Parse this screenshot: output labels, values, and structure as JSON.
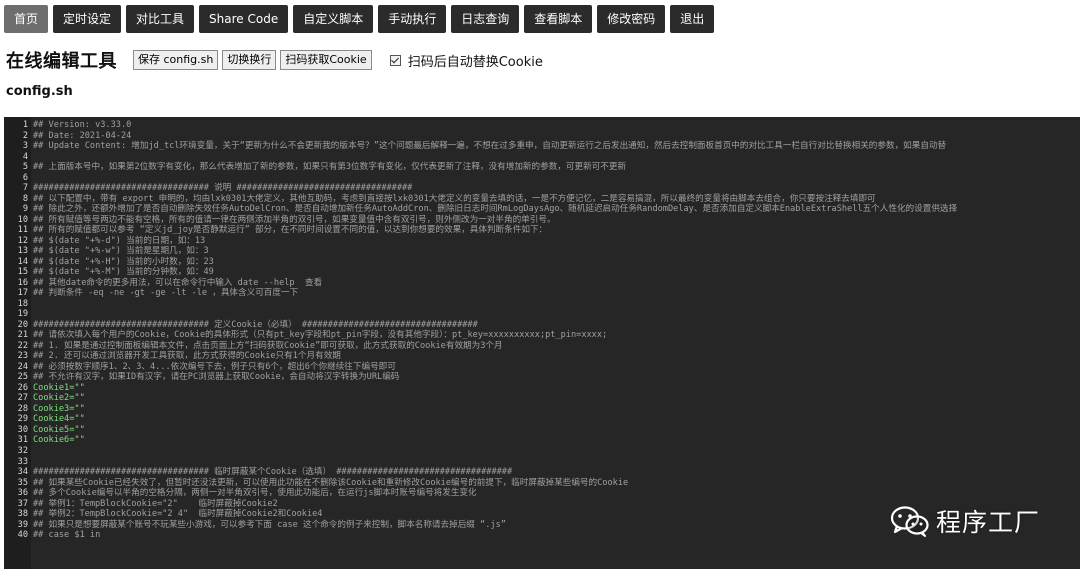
{
  "nav": {
    "items": [
      {
        "label": "首页",
        "active": true
      },
      {
        "label": "定时设定"
      },
      {
        "label": "对比工具"
      },
      {
        "label": "Share Code"
      },
      {
        "label": "自定义脚本"
      },
      {
        "label": "手动执行"
      },
      {
        "label": "日志查询"
      },
      {
        "label": "查看脚本"
      },
      {
        "label": "修改密码"
      },
      {
        "label": "退出"
      }
    ]
  },
  "header": {
    "title": "在线编辑工具",
    "buttons": {
      "save": "保存 config.sh",
      "wrap": "切换换行",
      "scan": "扫码获取Cookie"
    },
    "auto_replace": {
      "label": "扫码后自动替换Cookie",
      "checked": true
    }
  },
  "file": {
    "name": "config.sh"
  },
  "editor": {
    "lines": [
      {
        "n": "1",
        "t": "## Version: v3.33.0"
      },
      {
        "n": "2",
        "t": "## Date: 2021-04-24"
      },
      {
        "n": "3",
        "t": "## Update Content: 增加jd_tcl环境变量，关于“更新为什么不会更新我的版本号？”这个问题最后解释一遍，不想在过多重申，自动更新运行之后发出通知，然后去控制面板首页中的对比工具一栏自行对比替换相关的参数，如果自动替"
      },
      {
        "n": "4",
        "t": ""
      },
      {
        "n": "5",
        "t": "## 上面版本号中，如果第2位数字有变化，那么代表增加了新的参数，如果只有第3位数字有变化，仅代表更新了注释，没有增加新的参数，可更新可不更新"
      },
      {
        "n": "6",
        "t": ""
      },
      {
        "n": "7",
        "t": "################################## 说明 ##################################"
      },
      {
        "n": "8",
        "t": "## 以下配置中，带有 export 申明的，均由lxk0301大佬定义，其他互助码，考虑到直接按lxk0301大佬定义的变量去填的话，一是不方便记忆，二是容易搞混，所以最终的变量将由脚本去组合，你只要按注释去填即可"
      },
      {
        "n": "9",
        "t": "## 除此之外，还额外增加了是否自动删除失效任务AutoDelCron、是否自动增加新任务AutoAddCron、删除旧日志时间RmLogDaysAgo、随机延迟启动任务RandomDelay、是否添加自定义脚本EnableExtraShell五个人性化的设置供选择"
      },
      {
        "n": "10",
        "t": "## 所有赋值等号两边不能有空格，所有的值请一律在两侧添加半角的双引号，如果变量值中含有双引号，则外侧改为一对半角的单引号。"
      },
      {
        "n": "11",
        "t": "## 所有的赋值都可以参考 “定义jd_joy是否静默运行” 部分，在不同时间设置不同的值，以达到你想要的效果，具体判断条件如下："
      },
      {
        "n": "12",
        "t": "## $(date \"+%-d\") 当前的日期，如：13"
      },
      {
        "n": "13",
        "t": "## $(date \"+%-w\") 当前是星期几，如：3"
      },
      {
        "n": "14",
        "t": "## $(date \"+%-H\") 当前的小时数，如：23"
      },
      {
        "n": "15",
        "t": "## $(date \"+%-M\") 当前的分钟数，如：49"
      },
      {
        "n": "16",
        "t": "## 其他date命令的更多用法，可以在命令行中输入 date --help  查看"
      },
      {
        "n": "17",
        "t": "## 判断条件 -eq -ne -gt -ge -lt -le ，具体含义可百度一下"
      },
      {
        "n": "18",
        "t": ""
      },
      {
        "n": "19",
        "t": ""
      },
      {
        "n": "20",
        "t": "################################## 定义Cookie（必填） ##################################"
      },
      {
        "n": "21",
        "t": "## 请依次填入每个用户的Cookie，Cookie的具体形式（只有pt_key字段和pt_pin字段，没有其他字段）：pt_key=xxxxxxxxxx;pt_pin=xxxx;"
      },
      {
        "n": "22",
        "t": "## 1. 如果是通过控制面板编辑本文件，点击页面上方“扫码获取Cookie”即可获取，此方式获取的Cookie有效期为3个月"
      },
      {
        "n": "23",
        "t": "## 2. 还可以通过浏览器开发工具获取，此方式获得的Cookie只有1个月有效期"
      },
      {
        "n": "24",
        "t": "## 必须按数字顺序1、2、3、4...依次编号下去，例子只有6个，超出6个你继续往下编号即可"
      },
      {
        "n": "25",
        "t": "## 不允许有汉字，如果ID有汉字，请在PC浏览器上获取Cookie，会自动将汉字转换为URL编码"
      },
      {
        "n": "26",
        "t": "Cookie1=\"\"",
        "kw": true
      },
      {
        "n": "27",
        "t": "Cookie2=\"\"",
        "kw": true
      },
      {
        "n": "28",
        "t": "Cookie3=\"\"",
        "kw": true
      },
      {
        "n": "29",
        "t": "Cookie4=\"\"",
        "kw": true
      },
      {
        "n": "30",
        "t": "Cookie5=\"\"",
        "kw": true
      },
      {
        "n": "31",
        "t": "Cookie6=\"\"",
        "kw": true
      },
      {
        "n": "32",
        "t": ""
      },
      {
        "n": "33",
        "t": ""
      },
      {
        "n": "34",
        "t": "################################## 临时屏蔽某个Cookie（选填） ##################################"
      },
      {
        "n": "35",
        "t": "## 如果某些Cookie已经失效了，但暂时还没法更新，可以使用此功能在不删除该Cookie和重新修改Cookie编号的前提下，临时屏蔽掉某些编号的Cookie"
      },
      {
        "n": "36",
        "t": "## 多个Cookie编号以半角的空格分隔，两侧一对半角双引号，使用此功能后，在运行js脚本时账号编号将发生变化"
      },
      {
        "n": "37",
        "t": "## 举例1：TempBlockCookie=\"2\"    临时屏蔽掉Cookie2"
      },
      {
        "n": "38",
        "t": "## 举例2：TempBlockCookie=\"2 4\"  临时屏蔽掉Cookie2和Cookie4"
      },
      {
        "n": "39",
        "t": "## 如果只是想要屏蔽某个账号不玩某些小游戏，可以参考下面 case 这个命令的例子来控制，脚本名称请去掉后缀 “.js”"
      },
      {
        "n": "40",
        "t": "## case $1 in"
      }
    ]
  },
  "watermark": {
    "text": "程序工厂",
    "icon": "wechat-icon"
  }
}
